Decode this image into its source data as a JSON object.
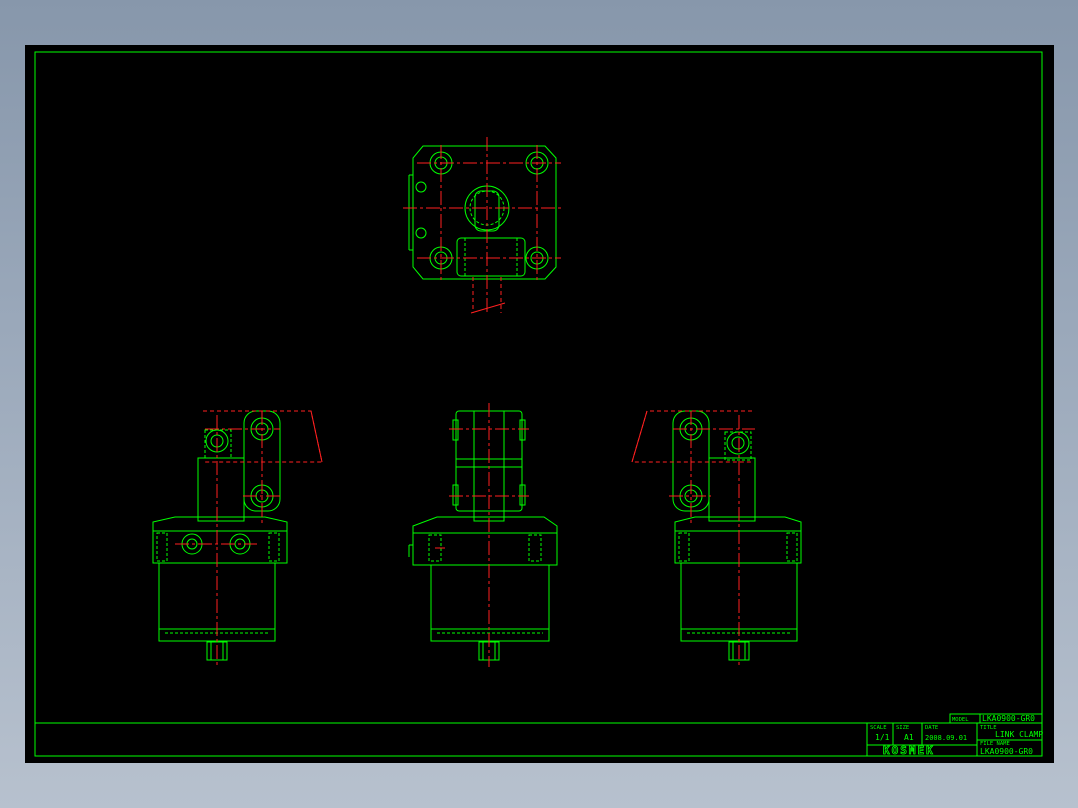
{
  "title_block": {
    "model_label": "MODEL",
    "model_value": "LKA0900-GR0",
    "title_label": "TITLE",
    "title_value": "LINK CLAMP",
    "file_label": "FILE NAME",
    "file_value": "LKA0900-GR0",
    "scale_label": "SCALE",
    "scale_value": "1/1",
    "size_label": "SIZE",
    "size_value": "A1",
    "date_label": "DATE",
    "date_value": "2008.09.01",
    "logo_text": "KOSMEK"
  },
  "colors": {
    "background": "#000000",
    "outline": "#00ff00",
    "centerline": "#ff2020"
  }
}
